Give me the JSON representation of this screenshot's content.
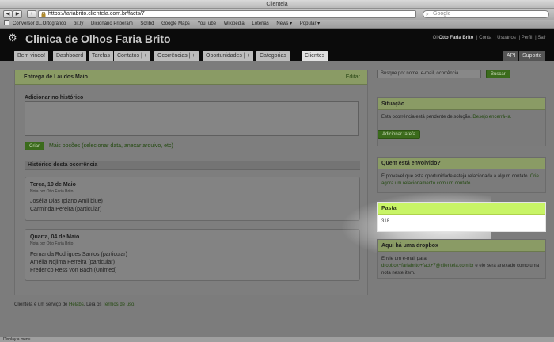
{
  "browser": {
    "window_title": "Clientela",
    "url": "https://fariabrito.clientela.com.br/facts/7",
    "search_placeholder": "Google",
    "bookmarks": [
      "Conversor d...Ortográfico",
      "bit.ly",
      "Dicionário Priberam",
      "Scribd",
      "Google Maps",
      "YouTube",
      "Wikipedia",
      "Loterias",
      "News ▾",
      "Popular ▾"
    ]
  },
  "header": {
    "app_title": "Clinica de Olhos Faria Brito",
    "greeting_prefix": "Oi",
    "user_name": "Otto Faria Brito",
    "links": [
      "| Conta",
      "| Usuários",
      "| Perfil",
      "| Sair"
    ],
    "tabs": [
      "Bem vindo!",
      "Dashboard",
      "Tarefas",
      "Contatos | +",
      "Ocorrências | +",
      "Oportunidades | +",
      "Categorias",
      "Clientes"
    ],
    "right_tabs": [
      "API",
      "Suporte"
    ]
  },
  "main": {
    "title": "Entrega de Laudos Maio",
    "edit_label": "Editar",
    "add_history_label": "Adicionar no histórico",
    "create_button": "Criar",
    "more_options": "Mais opções (selecionar data, anexar arquivo, etc)",
    "history_label": "Histórico desta ocorrência",
    "entries": [
      {
        "date": "Terça, 10 de Maio",
        "by": "Nota por Otto Faria Brito",
        "lines": [
          "Josélia Dias (plano Amil blue)",
          "Carminda Pereira (particular)"
        ]
      },
      {
        "date": "Quarta, 04 de Maio",
        "by": "Nota por Otto Faria Brito",
        "lines": [
          "Fernanda Rodrigues Santos (particular)",
          "Amélia Nojima Ferreira (particular)",
          "Frederico Ress von Bach (Unimed)"
        ]
      }
    ]
  },
  "footer": {
    "prefix": "Clientela é um serviço de",
    "brand": "Helabs",
    "middle": ". Leia os",
    "terms": "Termos de uso",
    "suffix": "."
  },
  "sidebar": {
    "search_placeholder": "Busque por nome, e-mail, ocorrência...",
    "search_button": "Buscar",
    "situacao": {
      "title": "Situação",
      "text": "Esta ocorrência está pendente de solução.",
      "link": "Desejo encerrá-la.",
      "button": "Adicionar tarefa"
    },
    "envolvido": {
      "title": "Quem está envolvido?",
      "text": "É provável que esta oportunidade esteja relacionada a algum contato.",
      "link": "Crie agora um relacionamento com um contato."
    },
    "pasta": {
      "title": "Pasta",
      "value": "318"
    },
    "dropbox": {
      "title": "Aqui há uma dropbox",
      "text_before": "Envie um e-mail para:",
      "email": "dropbox+fariabrito+fact+7@clientela.com.br",
      "text_after": "e ele será anexado como uma nota neste item."
    }
  },
  "status_bar": "Display a menu"
}
